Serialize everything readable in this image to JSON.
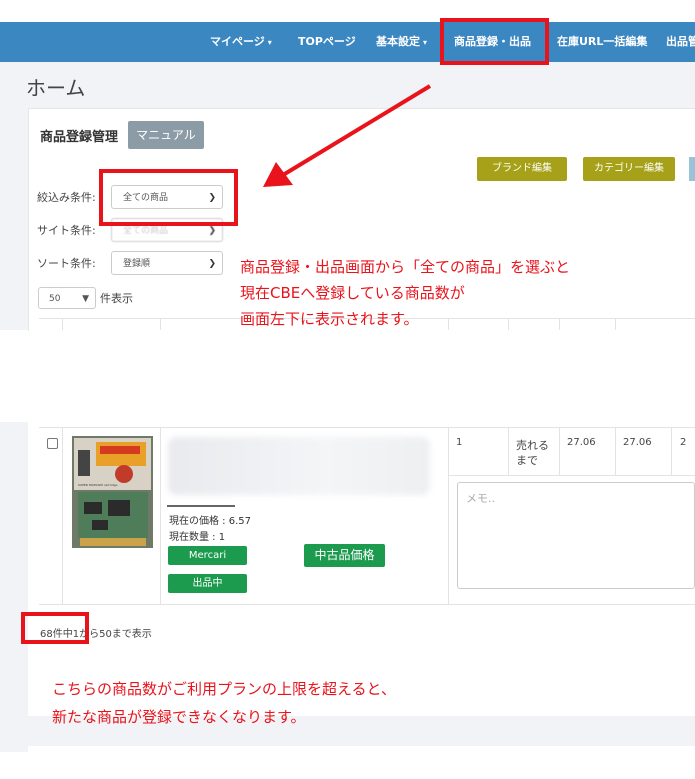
{
  "nav": {
    "items": [
      {
        "label": "マイページ",
        "caret": "▾"
      },
      {
        "label": "TOPページ",
        "caret": ""
      },
      {
        "label": "基本設定",
        "caret": "▾"
      },
      {
        "label": "商品登録・出品",
        "caret": ""
      },
      {
        "label": "在庫URL一括編集",
        "caret": ""
      },
      {
        "label": "出品管",
        "caret": ""
      }
    ]
  },
  "page": {
    "title": "ホーム"
  },
  "panel": {
    "title": "商品登録管理",
    "manual_button": "マニュアル",
    "brand_edit_button": "ブランド編集",
    "category_edit_button": "カテゴリー編集"
  },
  "filters": {
    "narrow_label": "絞込み条件:",
    "narrow_value": "全ての商品",
    "site_label": "サイト条件:",
    "site_value": "全ての商品",
    "sort_label": "ソート条件:",
    "sort_value": "登録順",
    "per_page_value": "50",
    "per_page_label": "件表示"
  },
  "annotations": {
    "top_line1": "商品登録・出品画面から「全ての商品」を選ぶと",
    "top_line2": "現在CBEへ登録している商品数が",
    "top_line3": "画面左下に表示されます。",
    "bottom_line1": "こちらの商品数がご利用プランの上限を超えると、",
    "bottom_line2": "新たな商品が登録できなくなります。"
  },
  "row": {
    "image_label": "SUPER FAMICOM cartridge",
    "current_price": "現在の価格 : 6.57",
    "current_qty": "現在数量 : 1",
    "mercari_button": "Mercari",
    "listing_button": "出品中",
    "used_price_button": "中古品価格",
    "count": "1",
    "status_line1": "売れる",
    "status_line2": "まで",
    "value1": "27.06",
    "value2": "27.06",
    "value3": "2",
    "memo_placeholder": "メモ.."
  },
  "pagination": {
    "summary": "68件中1から50まで表示"
  },
  "colors": {
    "nav_bg": "#3b87c2",
    "olive_button": "#a6a119",
    "green_button": "#1c9a4e",
    "highlight_red": "#e8131b",
    "manual_button": "#8c9ca6"
  },
  "icons": {
    "dropdown": "chevron-down-icon"
  }
}
